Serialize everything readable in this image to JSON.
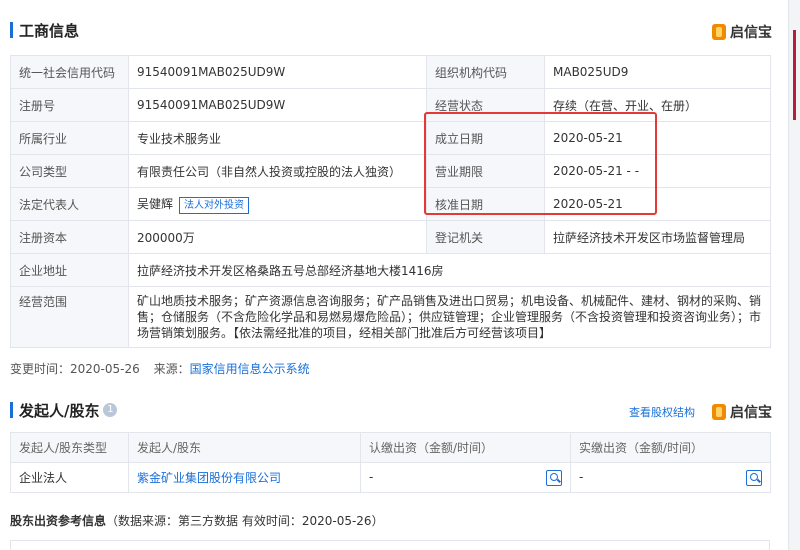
{
  "business_info": {
    "title": "工商信息",
    "brand": "启信宝",
    "rows": [
      {
        "l1": "统一社会信用代码",
        "v1": "91540091MAB025UD9W",
        "l2": "组织机构代码",
        "v2": "MAB025UD9"
      },
      {
        "l1": "注册号",
        "v1": "91540091MAB025UD9W",
        "l2": "经营状态",
        "v2": "存续（在营、开业、在册）"
      },
      {
        "l1": "所属行业",
        "v1": "专业技术服务业",
        "l2": "成立日期",
        "v2": "2020-05-21"
      },
      {
        "l1": "公司类型",
        "v1": "有限责任公司（非自然人投资或控股的法人独资）",
        "l2": "营业期限",
        "v2": "2020-05-21 - -"
      },
      {
        "l1": "法定代表人",
        "v1": "吴健辉",
        "l2": "核准日期",
        "v2": "2020-05-21"
      },
      {
        "l1": "注册资本",
        "v1": "200000万",
        "l2": "登记机关",
        "v2": "拉萨经济技术开发区市场监督管理局"
      }
    ],
    "invest_tag": "法人对外投资",
    "address_label": "企业地址",
    "address": "拉萨经济技术开发区格桑路五号总部经济基地大楼1416房",
    "scope_label": "经营范围",
    "scope": "矿山地质技术服务；矿产资源信息咨询服务；矿产品销售及进出口贸易；机电设备、机械配件、建材、钢材的采购、销售；仓储服务（不含危险化学品和易燃易爆危险品）；供应链管理；企业管理服务（不含投资管理和投资咨询业务）；市场营销策划服务。【依法需经批准的项目，经相关部门批准后方可经营该项目】"
  },
  "meta": {
    "change_label": "变更时间：",
    "change_date": "2020-05-26",
    "source_label": "来源：",
    "source_link": "国家信用信息公示系统"
  },
  "shareholders": {
    "title": "发起人/股东",
    "count": "1",
    "equity_link": "查看股权结构",
    "brand": "启信宝",
    "headers": [
      "发起人/股东类型",
      "发起人/股东",
      "认缴出资（金额/时间）",
      "实缴出资（金额/时间）"
    ],
    "rows": [
      {
        "type": "企业法人",
        "name": "紫金矿业集团股份有限公司",
        "subscribed": "-",
        "paid": "-"
      }
    ]
  },
  "ref_info": {
    "title": "股东出资参考信息",
    "note": "（数据来源：第三方数据 有效时间：2020-05-26）"
  }
}
